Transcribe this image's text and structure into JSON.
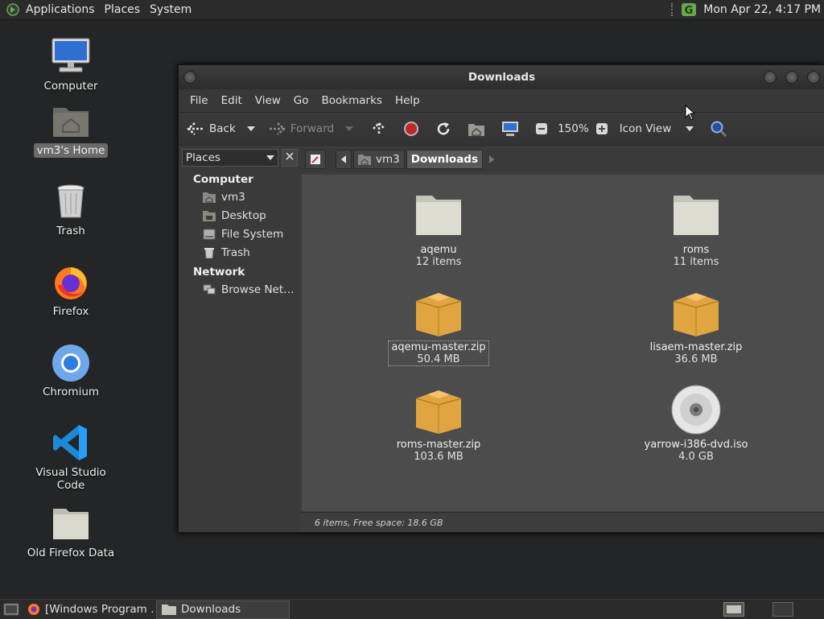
{
  "top_panel": {
    "menus": [
      "Applications",
      "Places",
      "System"
    ],
    "clock": "Mon Apr 22,  4:17 PM"
  },
  "desktop": {
    "icons": [
      {
        "label": "Computer",
        "icon": "computer-icon"
      },
      {
        "label": "vm3's Home",
        "icon": "home-folder-icon",
        "selected": true
      },
      {
        "label": "Trash",
        "icon": "trash-icon"
      },
      {
        "label": "Firefox",
        "icon": "firefox-icon"
      },
      {
        "label": "Chromium",
        "icon": "chromium-icon"
      },
      {
        "label": "Visual Studio Code",
        "icon": "vscode-icon"
      },
      {
        "label": "Old Firefox Data",
        "icon": "folder-icon"
      }
    ]
  },
  "window": {
    "title": "Downloads",
    "menu": [
      "File",
      "Edit",
      "View",
      "Go",
      "Bookmarks",
      "Help"
    ],
    "toolbar": {
      "back": "Back",
      "forward": "Forward",
      "zoom": "150%",
      "view_mode": "Icon View"
    },
    "sidebar": {
      "selector": "Places",
      "computer_heading": "Computer",
      "computer_items": [
        "vm3",
        "Desktop",
        "File System",
        "Trash"
      ],
      "network_heading": "Network",
      "network_items": [
        "Browse Net…"
      ]
    },
    "breadcrumb": [
      "vm3",
      "Downloads"
    ],
    "files": [
      {
        "name": "aqemu",
        "meta": "12 items",
        "type": "folder"
      },
      {
        "name": "roms",
        "meta": "11 items",
        "type": "folder"
      },
      {
        "name": "aqemu-master.zip",
        "meta": "50.4 MB",
        "type": "archive",
        "focused": true
      },
      {
        "name": "lisaem-master.zip",
        "meta": "36.6 MB",
        "type": "archive"
      },
      {
        "name": "roms-master.zip",
        "meta": "103.6 MB",
        "type": "archive"
      },
      {
        "name": "yarrow-i386-dvd.iso",
        "meta": "4.0 GB",
        "type": "disc"
      }
    ],
    "status": "6 items, Free space: 18.6 GB"
  },
  "taskbar": {
    "tasks": [
      "[Windows Program …",
      "Downloads"
    ]
  },
  "colors": {
    "folder": "#d8d8cc",
    "archive": "#e0a540",
    "accent_green": "#6aa84f"
  }
}
